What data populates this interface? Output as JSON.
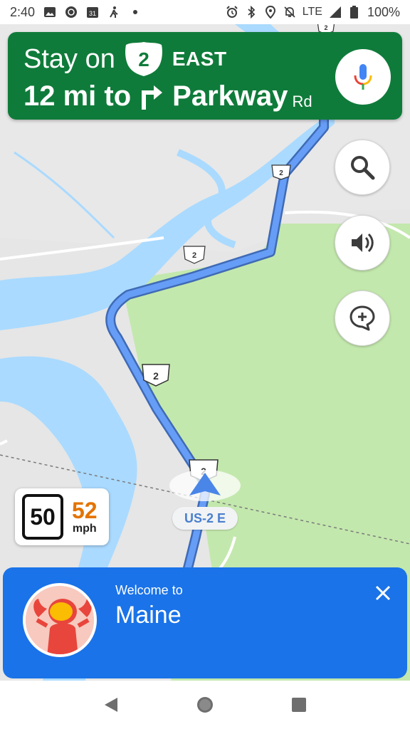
{
  "status_bar": {
    "time": "2:40",
    "calendar_day": "31",
    "network": "LTE",
    "battery": "100%"
  },
  "navigation": {
    "line1_prefix": "Stay on",
    "route_number": "2",
    "route_direction": "EAST",
    "distance": "12 mi to",
    "street_name": "Parkway",
    "street_suffix": "Rd"
  },
  "map": {
    "route_shields": [
      "2",
      "2",
      "2",
      "2",
      "2"
    ],
    "current_road": "US-2 E"
  },
  "speed": {
    "limit": "50",
    "current": "52",
    "unit": "mph"
  },
  "welcome_card": {
    "subtitle": "Welcome to",
    "title": "Maine"
  },
  "icons": {
    "mic": "mic-icon",
    "search": "search-icon",
    "sound": "volume-icon",
    "report": "add-report-icon",
    "close": "close-icon",
    "back": "back-icon",
    "home": "home-icon",
    "recents": "recents-icon"
  },
  "colors": {
    "banner_green": "#0f7b3a",
    "route_blue": "#4a86e8",
    "card_blue": "#1a73e8",
    "speed_orange": "#e37400",
    "water": "#aadaff",
    "park": "#c3e8ad"
  }
}
